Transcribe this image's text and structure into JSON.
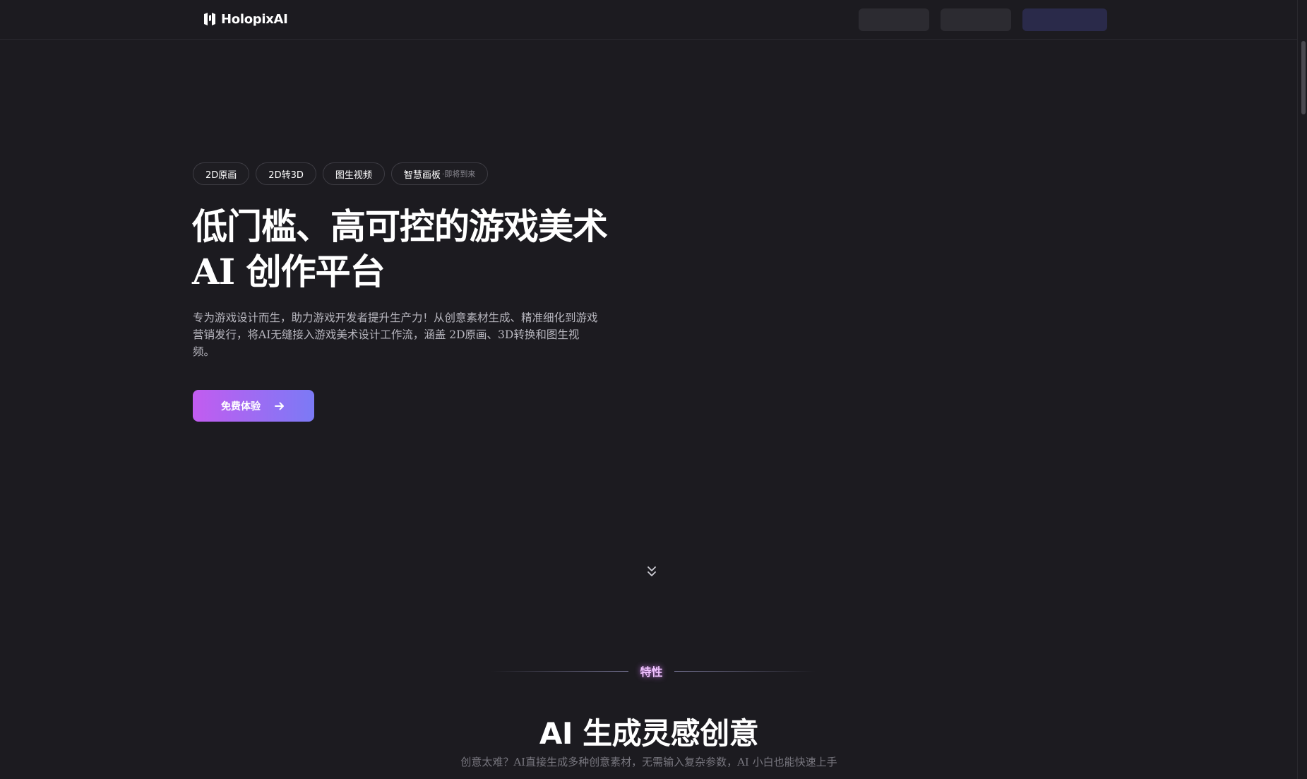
{
  "header": {
    "brand": "HolopixAI"
  },
  "hero": {
    "tags": [
      {
        "label": "2D原画"
      },
      {
        "label": "2D转3D"
      },
      {
        "label": "图生视频"
      },
      {
        "label": "智慧画板",
        "badge": "·即将到来"
      }
    ],
    "title_line1": "低门槛、高可控的游戏美术",
    "title_ai": "AI",
    "title_line2_rest": " 创作平台",
    "description": "专为游戏设计而生，助力游戏开发者提升生产力！从创意素材生成、精准细化到游戏营销发行，将AI无缝接入游戏美术设计工作流，涵盖 2D原画、3D转换和图生视频。",
    "cta_label": "免费体验"
  },
  "features": {
    "label": "特性",
    "title": "AI 生成灵感创意",
    "subtitle": "创意太难？AI直接生成多种创意素材，无需输入复杂参数，AI 小白也能快速上手"
  },
  "colors": {
    "background": "#1c1b20",
    "cta_gradient_start": "#c25cf0",
    "cta_gradient_end": "#7b7af5",
    "feature_label": "#f0c2ff"
  },
  "icons": {
    "logo": "holopix-logo-icon",
    "cta": "arrow-right-icon",
    "scroll": "double-chevron-down-icon"
  }
}
